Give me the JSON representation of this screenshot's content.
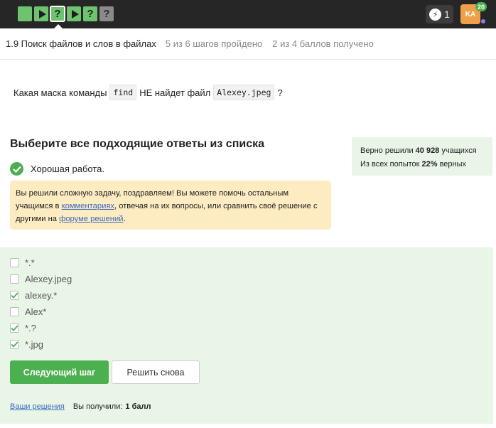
{
  "topbar": {
    "steps": [
      {
        "type": "square",
        "color": "green"
      },
      {
        "type": "play",
        "color": "green"
      },
      {
        "type": "question",
        "color": "green",
        "label": "?",
        "current": true
      },
      {
        "type": "play",
        "color": "green"
      },
      {
        "type": "question",
        "color": "green",
        "label": "?"
      },
      {
        "type": "question",
        "color": "grey",
        "label": "?"
      }
    ],
    "energy_count": "1",
    "avatar_initials": "KA",
    "avatar_badge": "20"
  },
  "lesson": {
    "title": "1.9 Поиск файлов и слов в файлах",
    "steps_progress": "5 из 6 шагов пройдено",
    "points_progress": "2 из 4 баллов  получено"
  },
  "question": {
    "text_before": "Какая маска команды",
    "code1": "find",
    "text_middle": "НЕ найдет файл",
    "code2": "Alexey.jpeg",
    "text_after": "?"
  },
  "answer": {
    "title": "Выберите все подходящие ответы из списка",
    "result": "Хорошая работа.",
    "congrats_part1": "Вы решили сложную задачу, поздравляем! Вы можете помочь остальным учащимся в ",
    "congrats_link1": "комментариях",
    "congrats_part2": ", отвечая на их вопросы, или сравнить своё решение с другими на ",
    "congrats_link2": "форуме решений",
    "congrats_part3": "."
  },
  "stats": {
    "line1_prefix": "Верно решили ",
    "line1_value": "40 928",
    "line1_suffix": " учащихся",
    "line2_prefix": "Из всех попыток ",
    "line2_value": "22%",
    "line2_suffix": " верных"
  },
  "options": [
    {
      "label": "*.*",
      "checked": false
    },
    {
      "label": "Alexey.jpeg",
      "checked": false
    },
    {
      "label": "alexey.*",
      "checked": true
    },
    {
      "label": "Alex*",
      "checked": false
    },
    {
      "label": "*.?",
      "checked": true
    },
    {
      "label": "*.jpg",
      "checked": true
    }
  ],
  "buttons": {
    "next": "Следующий шаг",
    "retry": "Решить снова"
  },
  "footer": {
    "solutions_link": "Ваши решения",
    "received_label": "Вы получили:",
    "received_value": "1 балл"
  },
  "colors": {
    "accent_green": "#4caf50",
    "topbar": "#262626",
    "congrats_bg": "#fdebc1",
    "success_bg": "#e9f6e7",
    "link": "#3d6bbf"
  }
}
